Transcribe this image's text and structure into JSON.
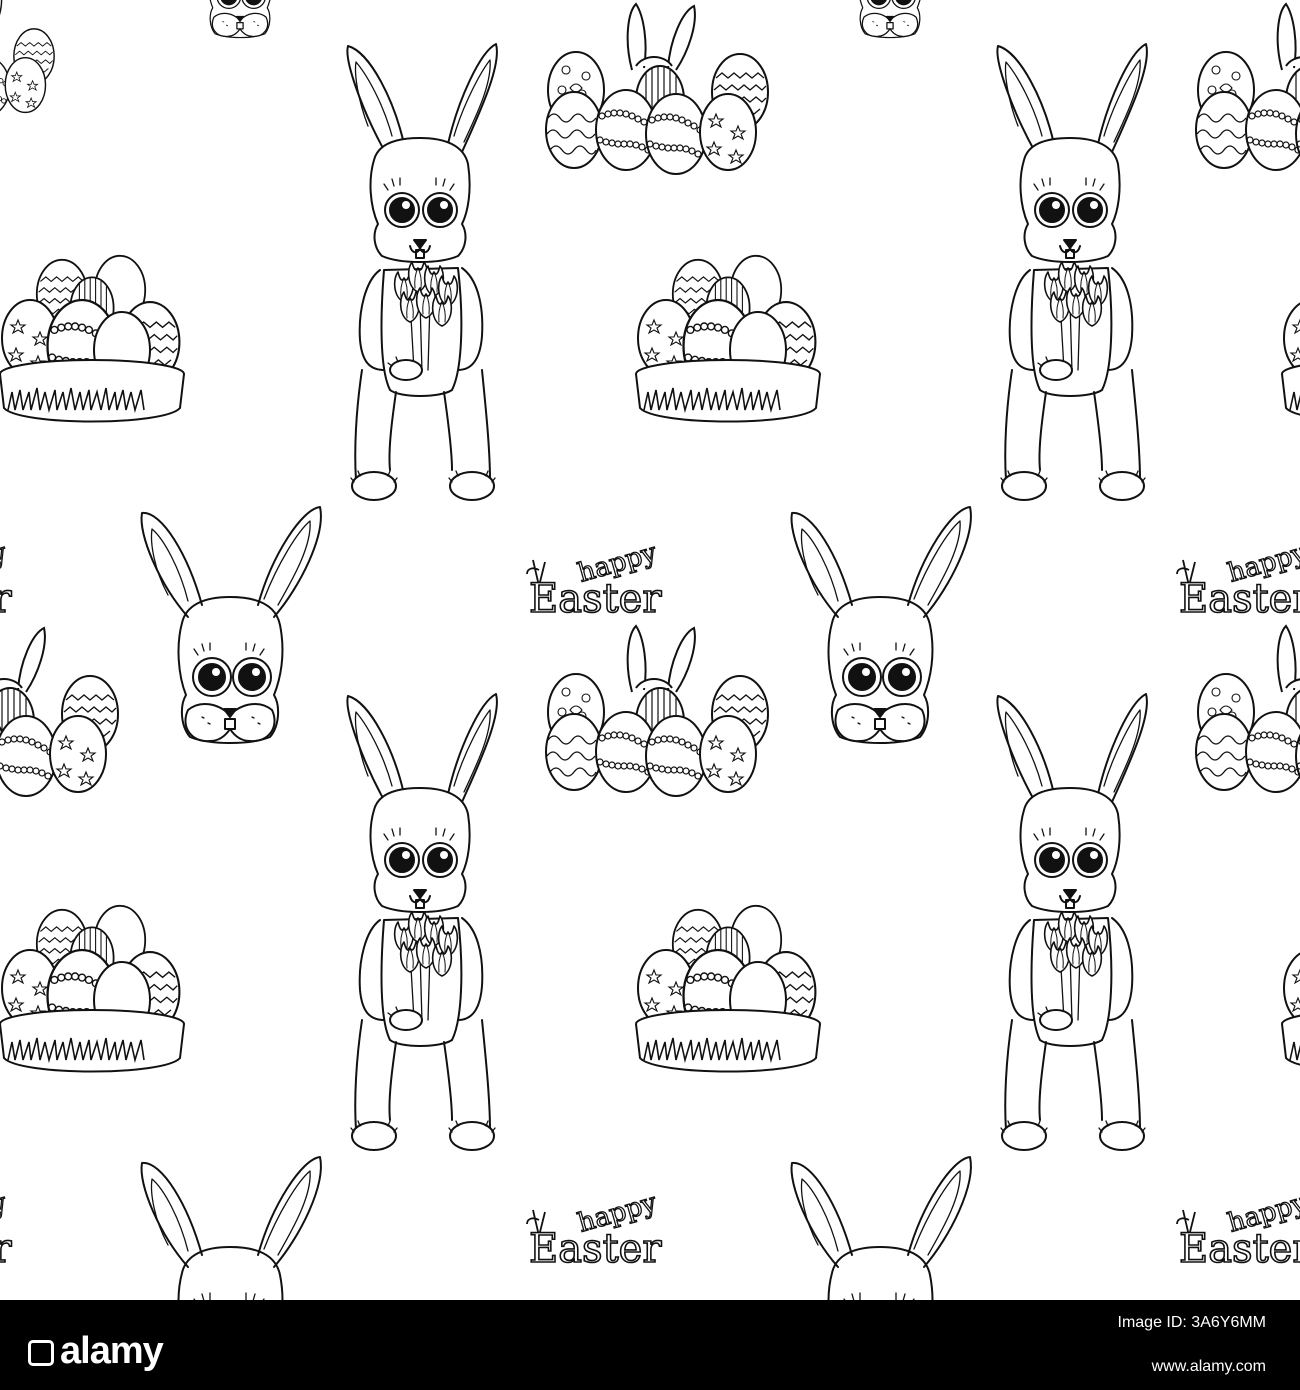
{
  "artwork": {
    "greeting_small": "happy",
    "greeting_large": "Easter",
    "ink_color": "#111111",
    "paper_color": "#ffffff",
    "motifs": [
      "bunny-head-icon",
      "bunny-standing-with-tulips-icon",
      "egg-basket-icon",
      "eggs-with-bunny-ears-icon",
      "happy-easter-lettering"
    ]
  },
  "footer": {
    "logo_text": "alamy",
    "image_id": "Image ID: 3A6Y6MM",
    "url": "www.alamy.com",
    "background": "#000000",
    "text_color": "#ffffff"
  }
}
